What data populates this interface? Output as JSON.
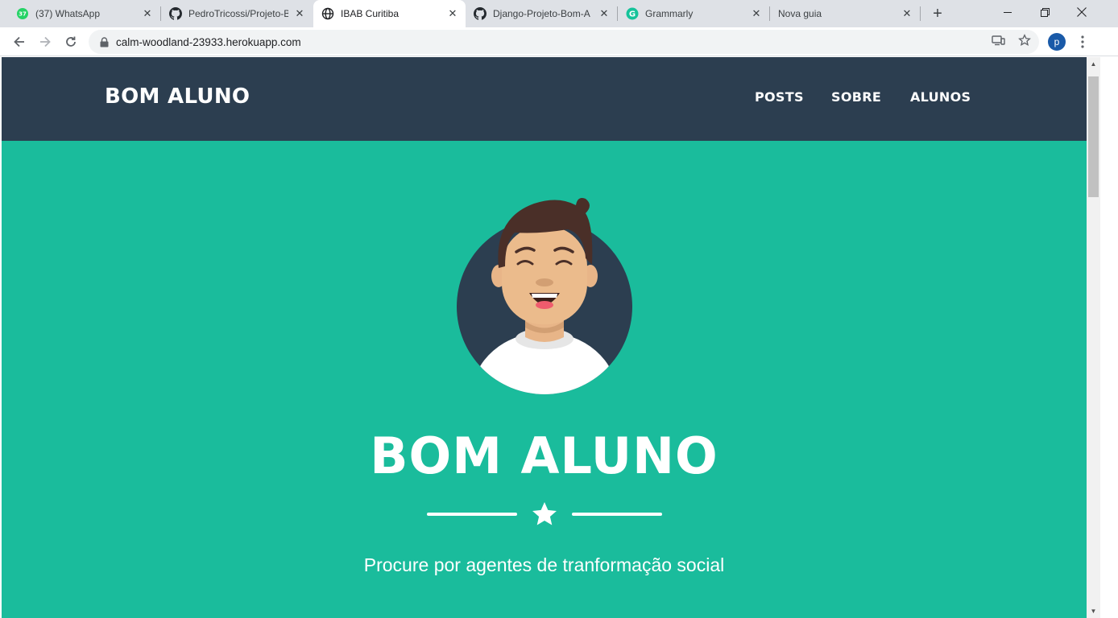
{
  "browser": {
    "tabs": [
      {
        "title": "(37) WhatsApp",
        "badge": "37",
        "icon": "whatsapp-icon",
        "active": false
      },
      {
        "title": "PedroTricossi/Projeto-B",
        "icon": "github-icon",
        "active": false
      },
      {
        "title": "IBAB Curitiba",
        "icon": "globe-icon",
        "active": true
      },
      {
        "title": "Django-Projeto-Bom-A",
        "icon": "github-icon",
        "active": false
      },
      {
        "title": "Grammarly",
        "icon": "grammarly-icon",
        "active": false
      },
      {
        "title": "Nova guia",
        "icon": "",
        "active": false
      }
    ],
    "new_tab_label": "+",
    "url": "calm-woodland-23933.herokuapp.com",
    "profile_initial": "p"
  },
  "site": {
    "brand": "BOM ALUNO",
    "nav": [
      "POSTS",
      "SOBRE",
      "ALUNOS"
    ],
    "hero_title": "BOM ALUNO",
    "hero_subtitle": "Procure por agentes de tranformação social"
  },
  "colors": {
    "navbar": "#2c3e50",
    "masthead": "#1abc9c",
    "text": "#ffffff"
  }
}
